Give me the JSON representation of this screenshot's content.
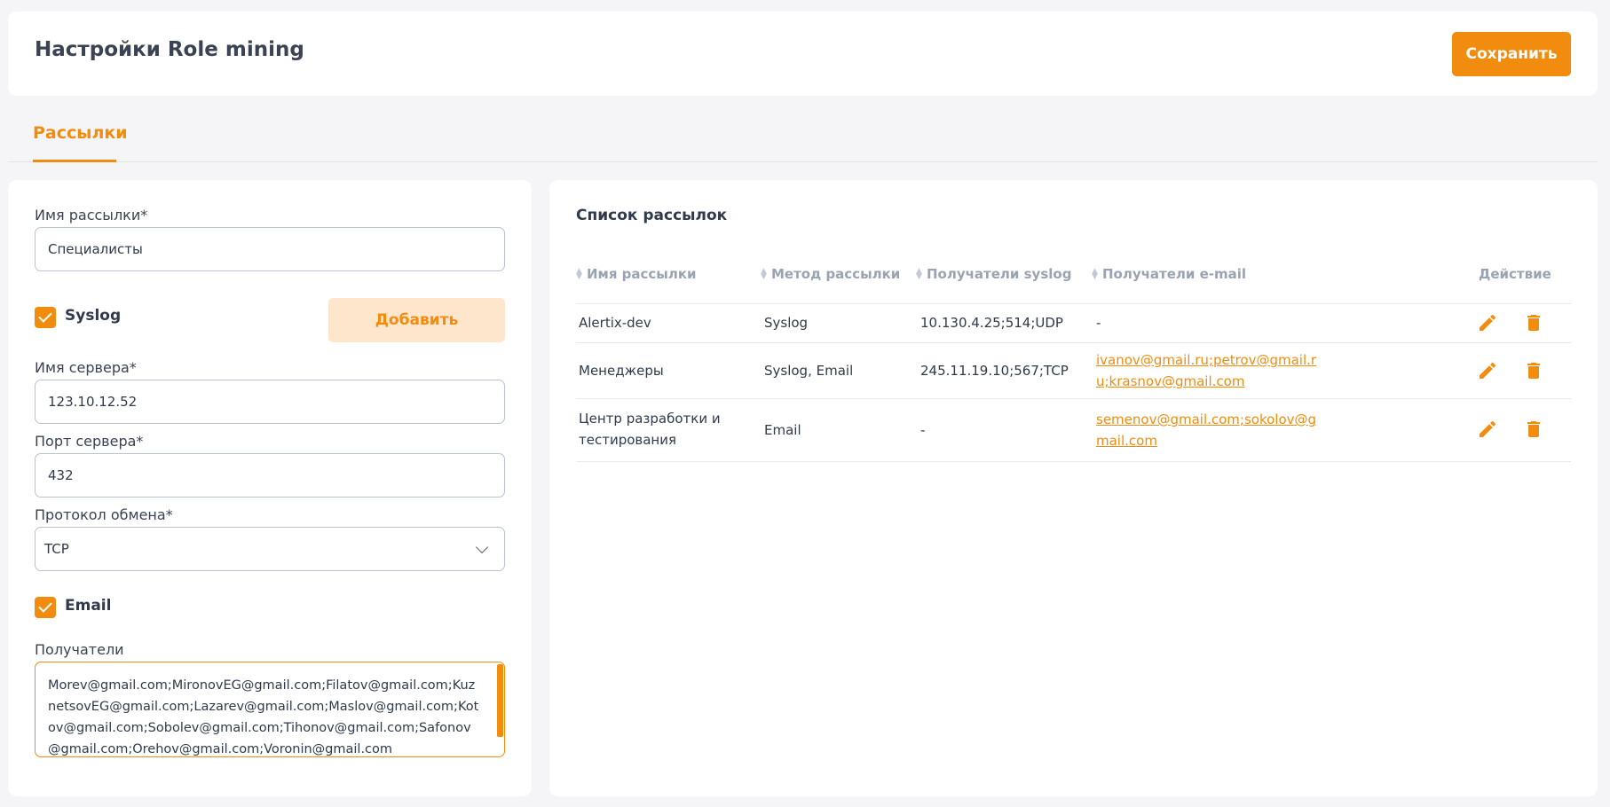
{
  "header": {
    "title": "Настройки Role mining",
    "save_label": "Сохранить"
  },
  "tabs": [
    {
      "label": "Рассылки",
      "active": true
    }
  ],
  "form": {
    "name_label": "Имя рассылки*",
    "name_value": "Специалисты",
    "syslog_label": "Syslog",
    "syslog_checked": true,
    "add_label": "Добавить",
    "server_label": "Имя сервера*",
    "server_value": "123.10.12.52",
    "port_label": "Порт сервера*",
    "port_value": "432",
    "protocol_label": "Протокол обмена*",
    "protocol_value": "TCP",
    "email_label": "Email",
    "email_checked": true,
    "recipients_label": "Получатели",
    "recipients_value": "Morev@gmail.com;MironovEG@gmail.com;Filatov@gmail.com;KuznetsovEG@gmail.com;Lazarev@gmail.com;Maslov@gmail.com;Kotov@gmail.com;Sobolev@gmail.com;Tihonov@gmail.com;Safonov@gmail.com;Orehov@gmail.com;Voronin@gmail.com"
  },
  "list": {
    "title": "Список рассылок",
    "columns": [
      "Имя рассылки",
      "Метод рассылки",
      "Получатели syslog",
      "Получатели e-mail",
      "Действие"
    ],
    "rows": [
      {
        "name": "Alertix-dev",
        "method": "Syslog",
        "syslog": "10.130.4.25;514;UDP",
        "email": "-"
      },
      {
        "name": "Менеджеры",
        "method": "Syslog, Email",
        "syslog": "245.11.19.10;567;TCP",
        "email": "ivanov@gmail.ru;petrov@gmail.ru;krasnov@gmail.com"
      },
      {
        "name": "Центр разработки и тестирования",
        "method": "Email",
        "syslog": "-",
        "email": "semenov@gmail.com;sokolov@gmail.com"
      }
    ]
  },
  "colors": {
    "accent": "#f28c0e",
    "accent_light": "#fde6cc"
  },
  "icons": [
    "chevron-down-icon",
    "checkmark-icon",
    "sort-icon",
    "pencil-icon",
    "trash-icon"
  ]
}
